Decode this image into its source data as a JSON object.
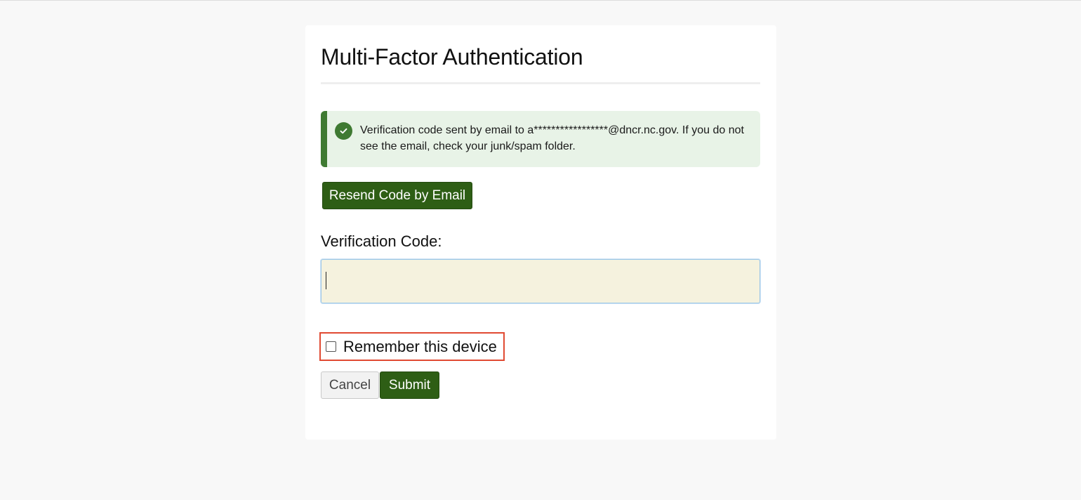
{
  "page": {
    "title": "Multi-Factor Authentication"
  },
  "alert": {
    "icon": "check-circle-icon",
    "message": "Verification code sent by email to a*****************@dncr.nc.gov. If you do not see the email, check your junk/spam folder.",
    "color": "#3f7a32",
    "background": "#e8f3e7"
  },
  "actions": {
    "resend_label": "Resend Code by Email",
    "cancel_label": "Cancel",
    "submit_label": "Submit"
  },
  "form": {
    "code_label": "Verification Code:",
    "code_value": "",
    "remember_label": "Remember this device",
    "remember_checked": false
  },
  "colors": {
    "primary_button": "#2e5e15",
    "highlight_border": "#e04a32",
    "input_background": "#f5f2de"
  }
}
